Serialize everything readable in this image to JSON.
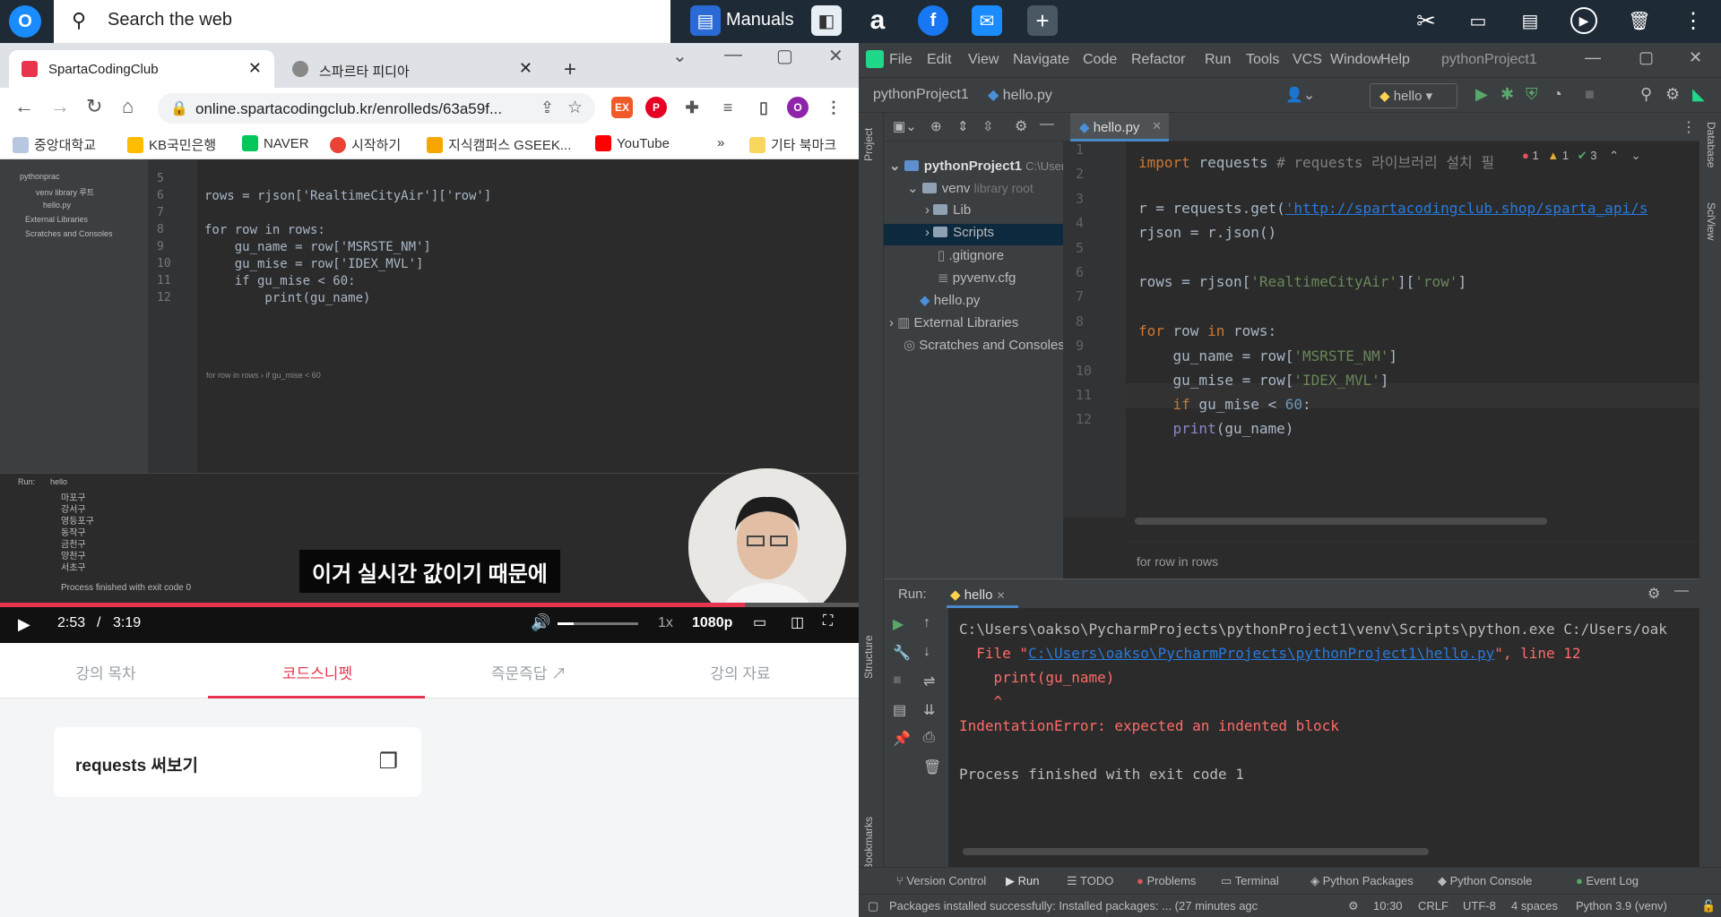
{
  "os": {
    "search_placeholder": "Search the web",
    "manuals": "Manuals"
  },
  "browser": {
    "tabs": [
      {
        "label": "SpartaCodingClub"
      },
      {
        "label": "스파르타 피디아"
      }
    ],
    "url": "online.spartacodingclub.kr/enrolleds/63a59f...",
    "profile_initial": "O",
    "bookmarks": [
      "중앙대학교",
      "KB국민은행",
      "NAVER",
      "시작하기",
      "지식캠퍼스 GSEEK...",
      "YouTube"
    ],
    "bookmarks_more": "»",
    "other_bookmarks": "기타 북마크"
  },
  "video": {
    "subtitle": "이거 실시간 값이기 때문에",
    "time_current": "2:53",
    "time_sep": "/",
    "time_total": "3:19",
    "progress": 0.867,
    "speed": "1x",
    "quality": "1080p",
    "code_lines": [
      {
        "n": "5",
        "t": ""
      },
      {
        "n": "6",
        "t": "rows = rjson['RealtimeCityAir']['row']"
      },
      {
        "n": "7",
        "t": ""
      },
      {
        "n": "8",
        "t": "for row in rows:"
      },
      {
        "n": "9",
        "t": "    gu_name = row['MSRSTE_NM']"
      },
      {
        "n": "10",
        "t": "    gu_mise = row['IDEX_MVL']"
      },
      {
        "n": "11",
        "t": "    if gu_mise < 60:"
      },
      {
        "n": "12",
        "t": "        print(gu_name)"
      }
    ],
    "crumb": "for row in rows  ›  if gu_mise < 60",
    "run_label": "Run:",
    "run_tab": "hello",
    "output_lines": [
      "마포구",
      "강서구",
      "영등포구",
      "동작구",
      "금천구",
      "양천구",
      "서초구"
    ],
    "process": "Process finished with exit code 0",
    "sidebar": [
      "pythonprac",
      "venv  library 루트",
      "hello.py",
      "External Libraries",
      "Scratches and Consoles"
    ]
  },
  "page": {
    "tabs": [
      "강의 목차",
      "코드스니펫",
      "즉문즉답",
      "강의 자료"
    ],
    "snippet": "requests 써보기"
  },
  "ide": {
    "menu": [
      "File",
      "Edit",
      "View",
      "Navigate",
      "Code",
      "Refactor",
      "Run",
      "Tools",
      "VCS",
      "Window",
      "Help"
    ],
    "window_title": "pythonProject1",
    "nav_project": "pythonProject1",
    "nav_file": "hello.py",
    "run_config": "hello",
    "project_label": "Project",
    "tree": [
      {
        "label": "pythonProject1",
        "extra": "C:\\Users\\"
      },
      {
        "label": "venv",
        "extra": "library root"
      },
      {
        "label": "Lib"
      },
      {
        "label": "Scripts"
      },
      {
        "label": ".gitignore"
      },
      {
        "label": "pyvenv.cfg"
      },
      {
        "label": "hello.py"
      },
      {
        "label": "External Libraries"
      },
      {
        "label": "Scratches and Consoles"
      }
    ],
    "editor_tab": "hello.py",
    "inspections": {
      "errors": "1",
      "warnings": "1",
      "ok": "3"
    },
    "code": {
      "l1_kw": "import",
      "l1_rest": " requests ",
      "l1_comment": "# requests 라이브러리 설치 필",
      "l3_a": "r = requests.get(",
      "l3_url": "'http://spartacodingclub.shop/sparta_api/s",
      "l4": "rjson = r.json()",
      "l6_a": "rows = rjson[",
      "l6_s1": "'RealtimeCityAir'",
      "l6_b": "][",
      "l6_s2": "'row'",
      "l6_c": "]",
      "l8_kw1": "for",
      "l8_a": " row ",
      "l8_kw2": "in",
      "l8_b": " rows:",
      "l9_a": "    gu_name = row[",
      "l9_s": "'MSRSTE_NM'",
      "l9_b": "]",
      "l10_a": "    gu_mise = row[",
      "l10_s": "'IDEX_MVL'",
      "l10_b": "]",
      "l11_kw": "    if",
      "l11_a": " gu_mise < ",
      "l11_n": "60",
      "l11_b": ":",
      "l12_bi": "    print",
      "l12_a": "(gu_name)"
    },
    "line_numbers": [
      "1",
      "2",
      "3",
      "4",
      "5",
      "6",
      "7",
      "8",
      "9",
      "10",
      "11",
      "12"
    ],
    "breadcrumb": "for row in rows",
    "run_label": "Run:",
    "run_tab": "hello",
    "output": {
      "cmd": "C:\\Users\\oakso\\PycharmProjects\\pythonProject1\\venv\\Scripts\\python.exe C:/Users/oak",
      "file_pre": "  File \"",
      "file_link": "C:\\Users\\oakso\\PycharmProjects\\pythonProject1\\hello.py",
      "file_post": "\", line 12",
      "code": "    print(gu_name)",
      "caret": "    ^",
      "error": "IndentationError: expected an indented block",
      "finish": "Process finished with exit code 1"
    },
    "left_strip": [
      "Structure",
      "Bookmarks"
    ],
    "right_strip": [
      "Database",
      "SciView"
    ],
    "bottom_tabs": [
      "Version Control",
      "Run",
      "TODO",
      "Problems",
      "Terminal",
      "Python Packages",
      "Python Console",
      "Event Log"
    ],
    "status": {
      "message": "Packages installed successfully: Installed packages: ... (27 minutes agc",
      "position": "10:30",
      "line_sep": "CRLF",
      "encoding": "UTF-8",
      "indent": "4 spaces",
      "interpreter": "Python 3.9 (venv)"
    }
  }
}
